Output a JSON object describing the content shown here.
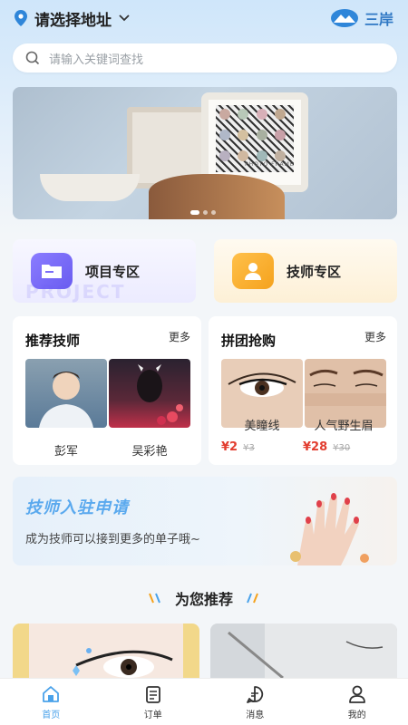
{
  "header": {
    "location_label": "请选择地址",
    "brand_name": "三岸"
  },
  "search": {
    "placeholder": "请输入关键词查找"
  },
  "banner": {
    "frame_text": "PHOTO FRAME"
  },
  "zones": {
    "project": {
      "label": "项目专区",
      "watermark": "PROJECT",
      "icon": "folder-icon",
      "color": "#6a5cf0"
    },
    "technician": {
      "label": "技师专区",
      "icon": "technician-icon",
      "color": "#f5a21d"
    }
  },
  "recommended_techs": {
    "title": "推荐技师",
    "more": "更多",
    "items": [
      {
        "name": "彭军"
      },
      {
        "name": "吴彩艳"
      }
    ]
  },
  "group_buy": {
    "title": "拼团抢购",
    "more": "更多",
    "items": [
      {
        "name": "美瞳线",
        "price": "¥2",
        "original_price": "¥3"
      },
      {
        "name": "人气野生眉",
        "price": "¥28",
        "original_price": "¥30"
      }
    ]
  },
  "join_banner": {
    "title": "技师入驻申请",
    "subtitle": "成为技师可以接到更多的单子哦~"
  },
  "recommend_section": {
    "title": "为您推荐"
  },
  "tabbar": {
    "items": [
      {
        "label": "首页",
        "icon": "home-icon",
        "active": true
      },
      {
        "label": "订单",
        "icon": "order-icon",
        "active": false
      },
      {
        "label": "消息",
        "icon": "message-icon",
        "active": false
      },
      {
        "label": "我的",
        "icon": "profile-icon",
        "active": false
      }
    ]
  },
  "colors": {
    "accent": "#4aa2ea",
    "price": "#e23d2f",
    "brand": "#2f78c4"
  }
}
